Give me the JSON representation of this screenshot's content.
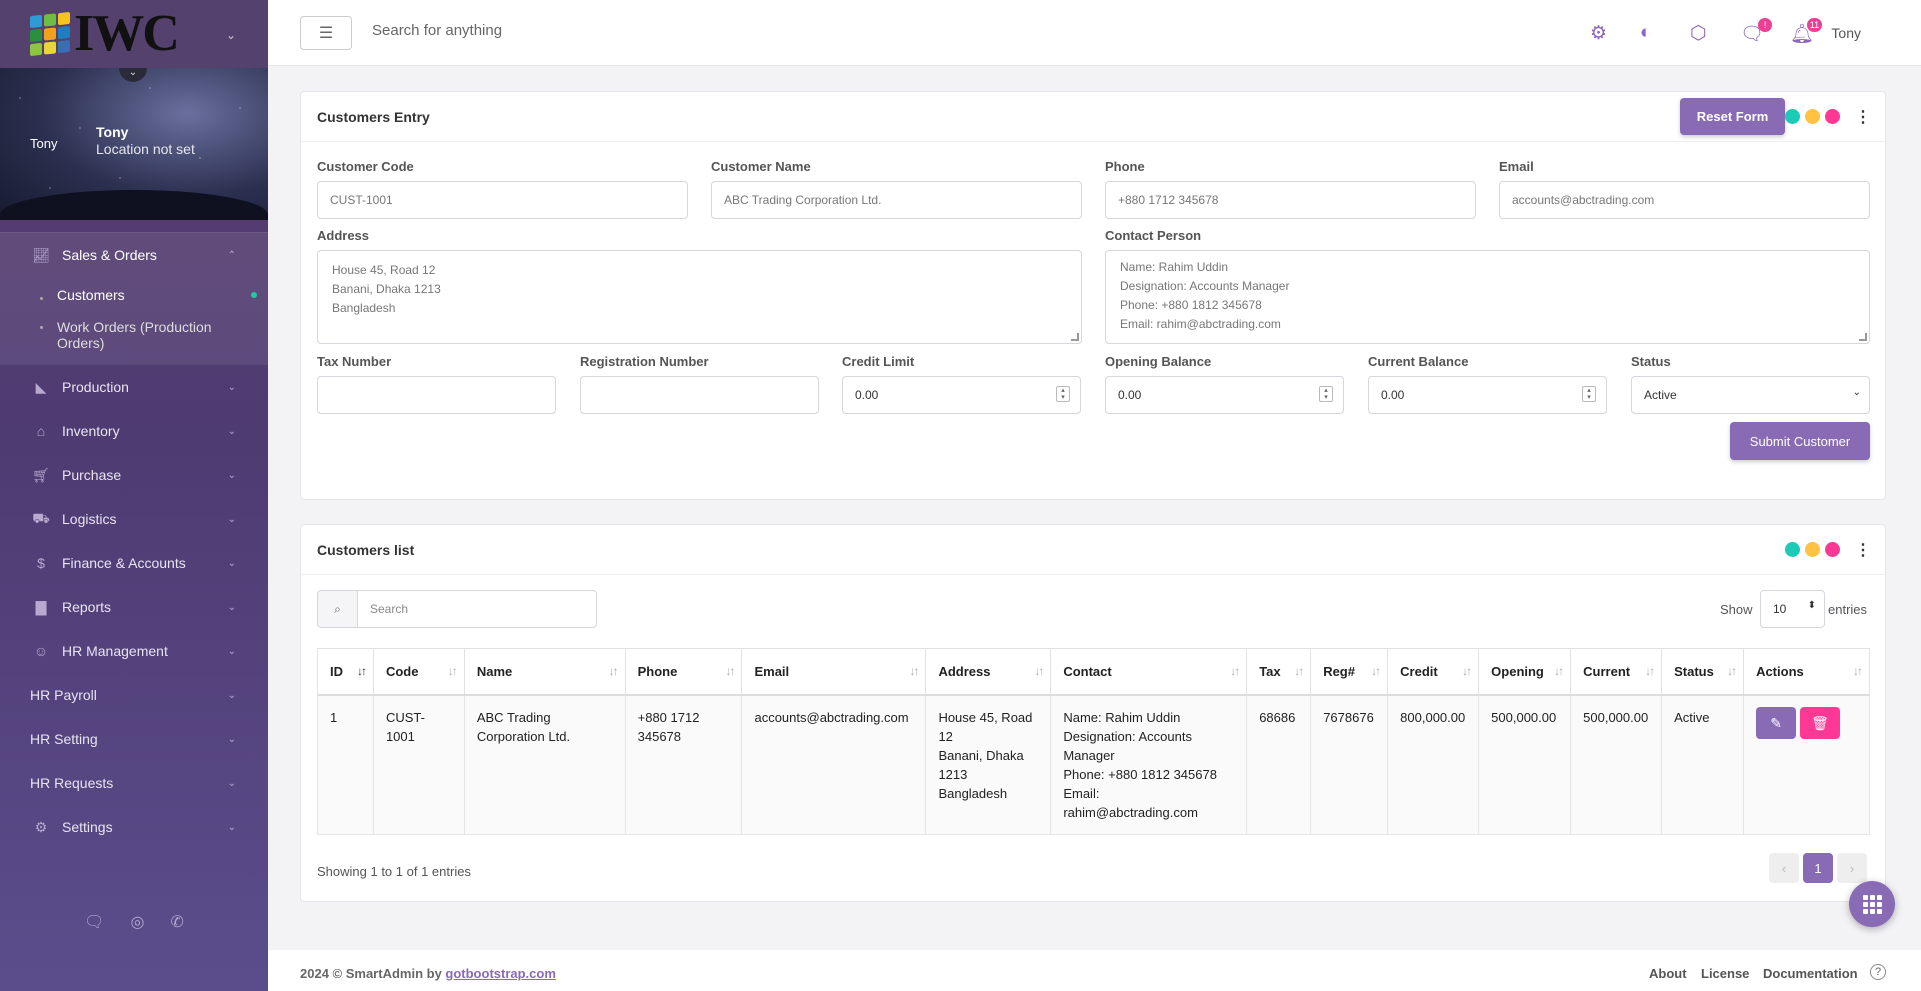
{
  "brand": {
    "logo_text": "IWC",
    "colors": [
      "#2f9bd6",
      "#6fbe44",
      "#f6c51b",
      "#2a8f3f",
      "#f2a11e",
      "#1e7fc0",
      "#8cc63f",
      "#e8d53a",
      "#3a6db8"
    ]
  },
  "profile": {
    "avatar_text": "Tony",
    "name": "Tony",
    "location": "Location not set"
  },
  "nav": {
    "open_section": {
      "label": "Sales & Orders",
      "icon": "chart-line-icon"
    },
    "sub_items": [
      {
        "label": "Customers"
      },
      {
        "label": "Work Orders (Production Orders)"
      }
    ],
    "sections": [
      {
        "label": "Production",
        "icon": "chart-area-icon"
      },
      {
        "label": "Inventory",
        "icon": "warehouse-icon"
      },
      {
        "label": "Purchase",
        "icon": "cart-icon"
      },
      {
        "label": "Logistics",
        "icon": "truck-icon"
      },
      {
        "label": "Finance & Accounts",
        "icon": "dollar-icon"
      },
      {
        "label": "Reports",
        "icon": "bar-chart-icon"
      },
      {
        "label": "HR Management",
        "icon": "user-icon"
      },
      {
        "label": "HR Payroll",
        "icon": ""
      },
      {
        "label": "HR Setting",
        "icon": ""
      },
      {
        "label": "HR Requests",
        "icon": ""
      },
      {
        "label": "Settings",
        "icon": "gear-icon"
      }
    ]
  },
  "topbar": {
    "search_placeholder": "Search for anything",
    "messages_badge": "!",
    "notifications_badge": "11",
    "user": "Tony"
  },
  "entry": {
    "title": "Customers Entry",
    "reset_label": "Reset Form",
    "submit_label": "Submit Customer",
    "fields": {
      "code_label": "Customer Code",
      "code_placeholder": "CUST-1001",
      "name_label": "Customer Name",
      "name_placeholder": "ABC Trading Corporation Ltd.",
      "phone_label": "Phone",
      "phone_placeholder": "+880 1712 345678",
      "email_label": "Email",
      "email_placeholder": "accounts@abctrading.com",
      "address_label": "Address",
      "address_placeholder": "House 45, Road 12\nBanani, Dhaka 1213\nBangladesh",
      "contact_label": "Contact Person",
      "contact_placeholder": "Name: Rahim Uddin\nDesignation: Accounts Manager\nPhone: +880 1812 345678\nEmail: rahim@abctrading.com",
      "tax_label": "Tax Number",
      "tax_value": "",
      "reg_label": "Registration Number",
      "reg_value": "",
      "credit_label": "Credit Limit",
      "credit_value": "0.00",
      "opening_label": "Opening Balance",
      "opening_value": "0.00",
      "current_label": "Current Balance",
      "current_value": "0.00",
      "status_label": "Status",
      "status_value": "Active"
    }
  },
  "list": {
    "title": "Customers list",
    "search_placeholder": "Search",
    "show_label": "Show",
    "entries_value": "10",
    "entries_label": "entries",
    "columns": [
      "ID",
      "Code",
      "Name",
      "Phone",
      "Email",
      "Address",
      "Contact",
      "Tax",
      "Reg#",
      "Credit",
      "Opening",
      "Current",
      "Status",
      "Actions"
    ],
    "rows": [
      {
        "id": "1",
        "code": "CUST-1001",
        "name": "ABC Trading Corporation Ltd.",
        "phone": "+880 1712 345678",
        "email": "accounts@abctrading.com",
        "address": "House 45, Road 12\nBanani, Dhaka 1213\nBangladesh",
        "contact": "Name: Rahim Uddin\nDesignation: Accounts Manager\nPhone: +880 1812 345678\nEmail: rahim@abctrading.com",
        "tax": "68686",
        "reg": "7678676",
        "credit": "800,000.00",
        "opening": "500,000.00",
        "current": "500,000.00",
        "status": "Active"
      }
    ],
    "info": "Showing 1 to 1 of 1 entries",
    "page": "1"
  },
  "footer": {
    "copyright": "2024 © SmartAdmin by ",
    "link": "gotbootstrap.com",
    "links": [
      "About",
      "License",
      "Documentation"
    ]
  },
  "colors": {
    "accent": "#886ab5",
    "danger": "#fd3995",
    "teal": "#1dc9b7",
    "amber": "#ffc241",
    "pink": "#fd3995"
  }
}
